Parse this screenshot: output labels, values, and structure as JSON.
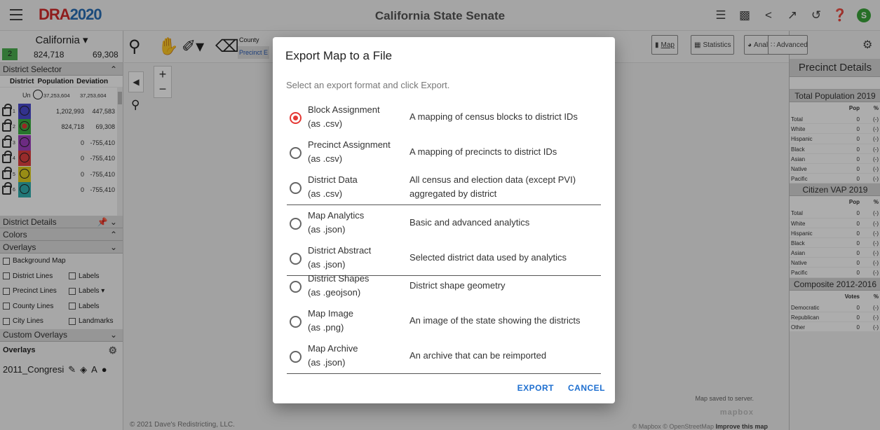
{
  "app": {
    "logo_part1": "DRA",
    "logo_part2": "2020",
    "title": "California State Senate"
  },
  "top_icons": [
    "list-icon",
    "feedback-icon",
    "share-icon",
    "expand-icon",
    "history-icon",
    "help-icon",
    "account-icon"
  ],
  "account_initial": "S",
  "left_panel": {
    "state_name": "California ▾",
    "district_count": "2",
    "population": "824,718",
    "deviation": "69,308",
    "district_selector_label": "District Selector",
    "col_district": "District",
    "col_population": "Population",
    "col_deviation": "Deviation",
    "unassigned": {
      "label": "Un",
      "population": "37,253,604",
      "deviation": "37,253,604"
    },
    "districts": [
      {
        "num": "1",
        "color": "#4a4ad0",
        "population": "1,202,993",
        "deviation": "447,583"
      },
      {
        "num": "2",
        "color": "#3cb043",
        "population": "824,718",
        "deviation": "69,308",
        "selected": true
      },
      {
        "num": "3",
        "color": "#a040c0",
        "population": "0",
        "deviation": "-755,410"
      },
      {
        "num": "4",
        "color": "#e04040",
        "population": "0",
        "deviation": "-755,410"
      },
      {
        "num": "5",
        "color": "#e0d020",
        "population": "0",
        "deviation": "-755,410"
      },
      {
        "num": "6",
        "color": "#30b0b0",
        "population": "0",
        "deviation": "-755,410"
      }
    ],
    "district_details_label": "District Details",
    "colors_label": "Colors",
    "overlays_label": "Overlays",
    "background_map": "Background Map",
    "district_lines": "District Lines",
    "labels": "Labels",
    "precinct_lines": "Precinct Lines",
    "precinct_labels": "Labels ▾",
    "county_lines": "County Lines",
    "city_lines": "City Lines",
    "landmarks": "Landmarks",
    "custom_overlays_label": "Custom Overlays",
    "overlays_header": "Overlays",
    "overlay_item": "2011_Congresi",
    "overlay_item_text_icon": "A"
  },
  "map": {
    "county_label": "County",
    "precinct_label": "Precinct",
    "precinct_suffix": "E",
    "view_buttons": {
      "map": "Map",
      "statistics": "Statistics",
      "analytics": "Analytics",
      "advanced": "Advanced"
    },
    "copyright": "© 2021 Dave's Redistricting, LLC.",
    "map_saved": "Map saved to server.",
    "mapbox_logo": "mapbox",
    "attribution_prefix": "© Mapbox © OpenStreetMap",
    "attribution_link": "Improve this map",
    "zoom_in": "+",
    "zoom_out": "−"
  },
  "right_panel": {
    "title": "Precinct Details",
    "sections": [
      {
        "title": "Total Population 2019",
        "col_value": "Pop",
        "col_pct": "%",
        "rows": [
          [
            "Total",
            "0",
            "(-)"
          ],
          [
            "White",
            "0",
            "(-)"
          ],
          [
            "Hispanic",
            "0",
            "(-)"
          ],
          [
            "Black",
            "0",
            "(-)"
          ],
          [
            "Asian",
            "0",
            "(-)"
          ],
          [
            "Native",
            "0",
            "(-)"
          ],
          [
            "Pacific",
            "0",
            "(-)"
          ]
        ]
      },
      {
        "title": "Citizen VAP 2019",
        "col_value": "Pop",
        "col_pct": "%",
        "rows": [
          [
            "Total",
            "0",
            "(-)"
          ],
          [
            "White",
            "0",
            "(-)"
          ],
          [
            "Hispanic",
            "0",
            "(-)"
          ],
          [
            "Black",
            "0",
            "(-)"
          ],
          [
            "Asian",
            "0",
            "(-)"
          ],
          [
            "Native",
            "0",
            "(-)"
          ],
          [
            "Pacific",
            "0",
            "(-)"
          ]
        ]
      },
      {
        "title": "Composite 2012-2016",
        "col_value": "Votes",
        "col_pct": "%",
        "rows": [
          [
            "Democratic",
            "0",
            "(-)"
          ],
          [
            "Republican",
            "0",
            "(-)"
          ],
          [
            "Other",
            "0",
            "(-)"
          ]
        ]
      }
    ]
  },
  "modal": {
    "title": "Export Map to a File",
    "subtitle": "Select an export format and click Export.",
    "options": [
      {
        "name": "Block Assignment",
        "ext": "(as .csv)",
        "desc": "A mapping of census blocks to district IDs",
        "selected": true
      },
      {
        "name": "Precinct Assignment",
        "ext": "(as .csv)",
        "desc": "A mapping of precincts to district IDs"
      },
      {
        "name": "District Data",
        "ext": "(as .csv)",
        "desc": "All census and election data (except PVI) aggregated by district"
      },
      {
        "name": "Map Analytics",
        "ext": "(as .json)",
        "desc": "Basic and advanced analytics"
      },
      {
        "name": "District Abstract",
        "ext": "(as .json)",
        "desc": "Selected district data used by analytics"
      },
      {
        "name": "District Shapes",
        "ext": "(as .geojson)",
        "desc": "District shape geometry"
      },
      {
        "name": "Map Image",
        "ext": "(as .png)",
        "desc": "An image of the state showing the districts"
      },
      {
        "name": "Map Archive",
        "ext": "(as .json)",
        "desc": "An archive that can be reimported"
      }
    ],
    "export_label": "EXPORT",
    "cancel_label": "CANCEL"
  }
}
